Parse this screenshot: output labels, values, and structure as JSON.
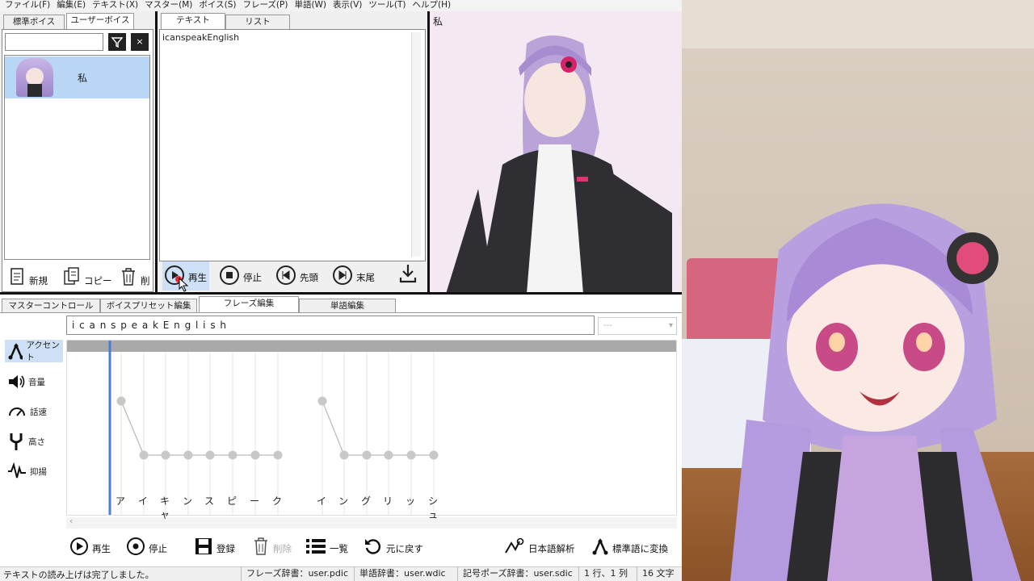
{
  "menu": [
    "ファイル(F)",
    "編集(E)",
    "テキスト(X)",
    "マスター(M)",
    "ボイス(S)",
    "フレーズ(P)",
    "単語(W)",
    "表示(V)",
    "ツール(T)",
    "ヘルプ(H)"
  ],
  "voice_tabs": {
    "standard": "標準ボイス",
    "user": "ユーザーボイス"
  },
  "voice_list": {
    "filter_value": "",
    "items": [
      {
        "name": "私"
      }
    ]
  },
  "voice_actions": {
    "new": "新規",
    "copy": "コピー",
    "delete": "削"
  },
  "text_tabs": {
    "text": "テキスト",
    "list": "リスト"
  },
  "text_content": "icanspeakEnglish",
  "playback": {
    "play": "再生",
    "stop": "停止",
    "head": "先頭",
    "tail": "末尾"
  },
  "preview_label": "私",
  "bottom_tabs": [
    "マスターコントロール",
    "ボイスプリセット編集",
    "フレーズ編集",
    "単語編集"
  ],
  "phrase_input": "i c a n s p e a k E n g l i s h",
  "phrase_select": "---",
  "side_buttons": [
    "アクセント",
    "音量",
    "話速",
    "高さ",
    "抑揚"
  ],
  "kana": [
    "ア",
    "イ",
    "キャ",
    "ン",
    "ス",
    "ピ",
    "ー",
    "ク",
    "イ",
    "ン",
    "グ",
    "リ",
    "ッ",
    "シュ"
  ],
  "accent_levels": [
    1,
    0,
    0,
    0,
    0,
    0,
    0,
    0,
    1,
    0,
    0,
    0,
    0,
    0
  ],
  "phrase_actions": {
    "play": "再生",
    "stop": "停止",
    "register": "登録",
    "delete": "削除",
    "list": "一覧",
    "undo": "元に戻す",
    "analyze": "日本語解析",
    "standardize": "標準語に変換"
  },
  "status": {
    "message": "テキストの読み上げは完了しました。",
    "phrase_dict": "フレーズ辞書：user.pdic",
    "word_dict": "単語辞書：user.wdic",
    "symbol_dict": "記号ポーズ辞書：user.sdic",
    "position": "1 行、1 列",
    "chars": "16 文字"
  },
  "colors": {
    "accent": "#4a7fd6",
    "selected_row": "#b9d7f5",
    "purple": "#b7a0d8",
    "pink": "#e05c86"
  }
}
